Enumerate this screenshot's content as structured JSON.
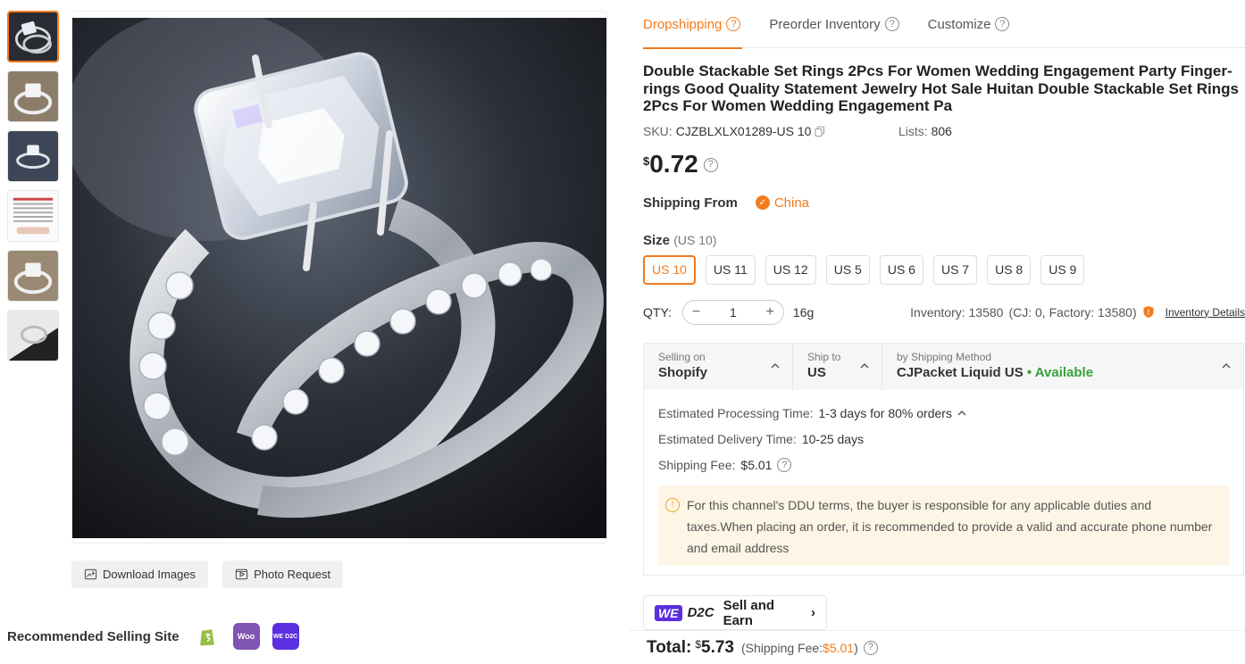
{
  "tabs": [
    {
      "label": "Dropshipping"
    },
    {
      "label": "Preorder Inventory"
    },
    {
      "label": "Customize"
    }
  ],
  "product": {
    "title": "Double Stackable Set Rings 2Pcs For Women Wedding Engagement Party Finger-rings Good Quality Statement Jewelry Hot Sale Huitan Double Stackable Set Rings 2Pcs For Women Wedding Engagement Pa",
    "sku_label": "SKU:",
    "sku": "CJZBLXLX01289-US 10",
    "lists_label": "Lists:",
    "lists": "806",
    "currency": "$",
    "price": "0.72"
  },
  "shipping_from": {
    "label": "Shipping From",
    "value": "China"
  },
  "size": {
    "label": "Size",
    "selected": "(US 10)",
    "options": [
      "US 10",
      "US 11",
      "US 12",
      "US 5",
      "US 6",
      "US 7",
      "US 8",
      "US 9"
    ]
  },
  "qty": {
    "label": "QTY:",
    "minus": "−",
    "value": "1",
    "plus": "+",
    "weight": "16g",
    "inventory": "Inventory: 13580",
    "inventory_detail": "(CJ: 0, Factory: 13580)",
    "details_link": "Inventory Details"
  },
  "shipping": {
    "selling_on_label": "Selling on",
    "selling_on": "Shopify",
    "ship_to_label": "Ship to",
    "ship_to": "US",
    "method_label": "by Shipping Method",
    "method": "CJPacket Liquid US",
    "available": "• Available",
    "processing_label": "Estimated Processing Time:",
    "processing": "1-3 days for 80% orders",
    "delivery_label": "Estimated Delivery Time:",
    "delivery": "10-25 days",
    "fee_label": "Shipping Fee:",
    "fee": "$5.01",
    "notice": "For this channel's DDU terms, the buyer is responsible for any applicable duties and taxes.When placing an order, it is recommended to provide a valid and accurate phone number and email address"
  },
  "image_actions": {
    "download": "Download Images",
    "photo_request": "Photo Request"
  },
  "recommended": {
    "label": "Recommended Selling Site",
    "sites": [
      "shopify-icon",
      "woo-icon",
      "we-d2c-icon"
    ],
    "woo_text": "Woo",
    "we_text": "WE D2C"
  },
  "d2c": {
    "we": "WE",
    "d2c": "D2C",
    "label": "Sell and Earn",
    "arrow": "›"
  },
  "total": {
    "label": "Total:",
    "currency": "$",
    "value": "5.73",
    "fee_open": "(Shipping Fee:",
    "fee": "$5.01",
    "fee_close": ")"
  },
  "colors": {
    "accent": "#f37b1d",
    "available": "#3aa03a",
    "we_purple": "#5b2ee0"
  }
}
